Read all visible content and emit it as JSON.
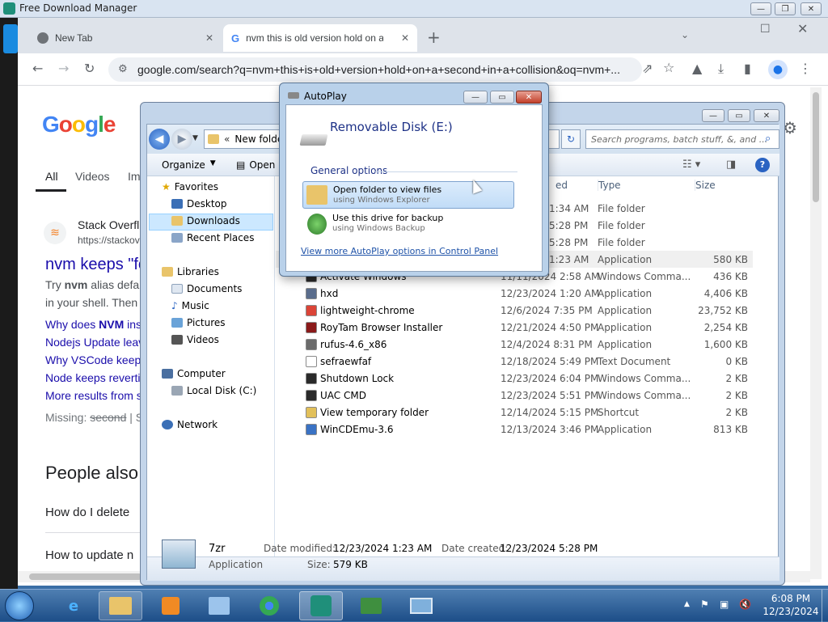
{
  "fdm": {
    "title": "Free Download Manager"
  },
  "chrome": {
    "tabs": [
      {
        "label": "New Tab"
      },
      {
        "label": "nvm this is old version hold on a"
      }
    ],
    "url": "google.com/search?q=nvm+this+is+old+version+hold+on+a+second+in+a+collision&oq=nvm+..."
  },
  "google": {
    "tabs": [
      "All",
      "Videos",
      "Im"
    ],
    "result": {
      "site": "Stack Overfl",
      "url": "https://stackov",
      "title": "nvm keeps \"fo",
      "snippet1_a": "Try ",
      "snippet1_b": "nvm",
      "snippet1_c": " alias defau",
      "snippet2": "in your shell. Then"
    },
    "links": [
      {
        "a": "Why does ",
        "b": "NVM",
        "c": " ins"
      },
      {
        "a": "Nodejs Update leav"
      },
      {
        "a": "Why VSCode keeps"
      },
      {
        "a": "Node keeps revertin"
      },
      {
        "a": "More results from s"
      }
    ],
    "missing_label": "Missing: ",
    "missing_word": "second",
    "missing_rest": " | S",
    "people_also": "People also",
    "questions": [
      "How do I delete",
      "How to update n"
    ]
  },
  "explorer": {
    "breadcrumb": "New folde",
    "search_placeholder": "Search programs, batch stuff, &, and ...",
    "cmd": {
      "organize": "Organize",
      "open": "Open"
    },
    "columns": {
      "date": "ed",
      "type": "Type",
      "size": "Size"
    },
    "nav": {
      "favorites": "Favorites",
      "desktop": "Desktop",
      "downloads": "Downloads",
      "recent": "Recent Places",
      "libraries": "Libraries",
      "documents": "Documents",
      "music": "Music",
      "pictures": "Pictures",
      "videos": "Videos",
      "computer": "Computer",
      "local_disk": "Local Disk (C:)",
      "network": "Network"
    },
    "partial_rows": [
      {
        "date": "1:34 AM",
        "type": "File folder",
        "size": ""
      },
      {
        "date": "5:28 PM",
        "type": "File folder",
        "size": ""
      },
      {
        "date": "5:28 PM",
        "type": "File folder",
        "size": ""
      },
      {
        "date": "1:23 AM",
        "type": "Application",
        "size": "580 KB"
      }
    ],
    "files": [
      {
        "name": "Activate Windows",
        "date": "11/11/2024 2:58 AM",
        "type": "Windows Comma...",
        "size": "436 KB",
        "icon": "cmd",
        "color": "#2a2a2a"
      },
      {
        "name": "hxd",
        "date": "12/23/2024 1:20 AM",
        "type": "Application",
        "size": "4,406 KB",
        "icon": "app",
        "color": "#5a6d8c"
      },
      {
        "name": "lightweight-chrome",
        "date": "12/6/2024 7:35 PM",
        "type": "Application",
        "size": "23,752 KB",
        "icon": "chrome",
        "color": "#db4437"
      },
      {
        "name": "RoyTam Browser Installer",
        "date": "12/21/2024 4:50 PM",
        "type": "Application",
        "size": "2,254 KB",
        "icon": "app",
        "color": "#8b1a1a"
      },
      {
        "name": "rufus-4.6_x86",
        "date": "12/4/2024 8:31 PM",
        "type": "Application",
        "size": "1,600 KB",
        "icon": "usb",
        "color": "#6b6b6b"
      },
      {
        "name": "sefraewfaf",
        "date": "12/18/2024 5:49 PM",
        "type": "Text Document",
        "size": "0 KB",
        "icon": "txt",
        "color": "#ffffff"
      },
      {
        "name": "Shutdown Lock",
        "date": "12/23/2024 6:04 PM",
        "type": "Windows Comma...",
        "size": "2 KB",
        "icon": "cmd",
        "color": "#2a2a2a"
      },
      {
        "name": "UAC CMD",
        "date": "12/23/2024 5:51 PM",
        "type": "Windows Comma...",
        "size": "2 KB",
        "icon": "cmd",
        "color": "#2a2a2a"
      },
      {
        "name": "View temporary folder",
        "date": "12/14/2024 5:15 PM",
        "type": "Shortcut",
        "size": "2 KB",
        "icon": "shortcut",
        "color": "#e2c05a"
      },
      {
        "name": "WinCDEmu-3.6",
        "date": "12/13/2024 3:46 PM",
        "type": "Application",
        "size": "813 KB",
        "icon": "disc",
        "color": "#3a72c4"
      }
    ],
    "details": {
      "name": "7zr",
      "kind": "Application",
      "modified_label": "Date modified:",
      "modified": "12/23/2024 1:23 AM",
      "created_label": "Date created:",
      "created": "12/23/2024 5:28 PM",
      "size_label": "Size:",
      "size": "579 KB"
    }
  },
  "autoplay": {
    "title": "AutoPlay",
    "drive": "Removable Disk (E:)",
    "section": "General options",
    "opt1_title": "Open folder to view files",
    "opt1_sub": "using Windows Explorer",
    "opt2_title": "Use this drive for backup",
    "opt2_sub": "using Windows Backup",
    "link": "View more AutoPlay options in Control Panel"
  },
  "taskbar": {
    "time": "6:08 PM",
    "date": "12/23/2024"
  },
  "colors": {
    "link": "#1a0dab",
    "selection": "#cce8ff",
    "taskbar": "#1d4e88"
  }
}
